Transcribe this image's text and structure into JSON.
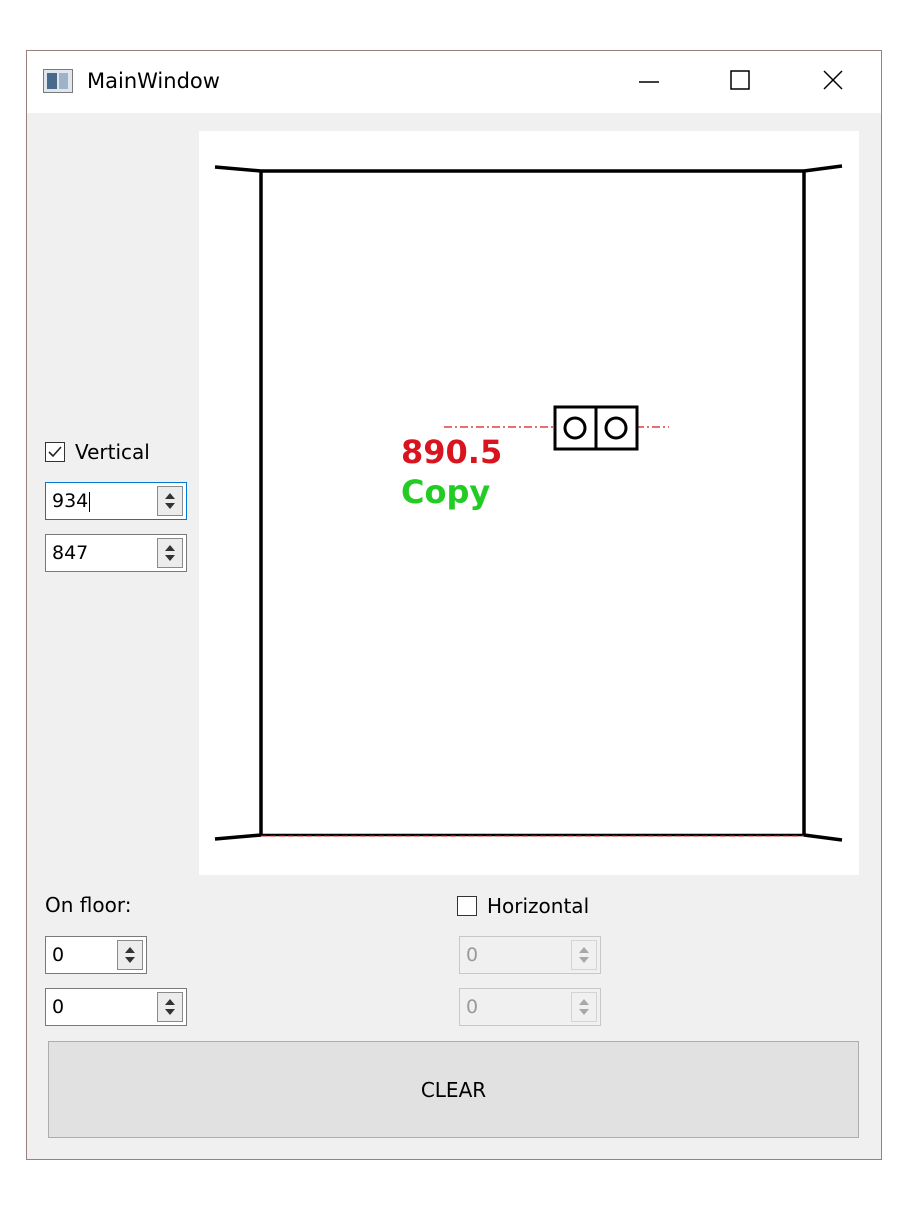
{
  "window": {
    "title": "MainWindow"
  },
  "canvas": {
    "value_label": "890.5",
    "copy_label": "Copy",
    "value_color": "#d9141e",
    "copy_color": "#22cc22"
  },
  "left_panel": {
    "vertical_checkbox": {
      "label": "Vertical",
      "checked": true
    },
    "spin1": {
      "value": "934"
    },
    "spin2": {
      "value": "847"
    }
  },
  "bottom": {
    "on_floor_label": "On floor:",
    "floor_spin1": {
      "value": "0"
    },
    "floor_spin2": {
      "value": "0"
    },
    "horizontal_checkbox": {
      "label": "Horizontal",
      "checked": false
    },
    "h_spin1": {
      "value": "0"
    },
    "h_spin2": {
      "value": "0"
    }
  },
  "clear_button": {
    "label": "CLEAR"
  }
}
